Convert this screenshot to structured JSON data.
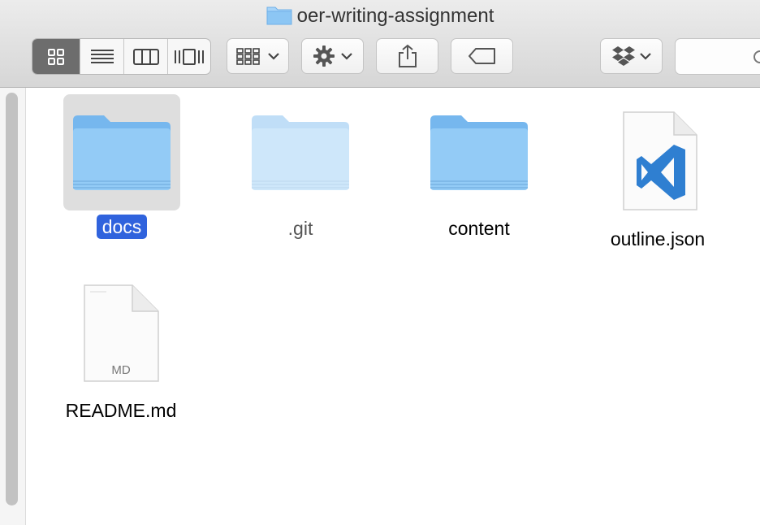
{
  "window": {
    "title": "oer-writing-assignment"
  },
  "toolbar": {
    "view_buttons": [
      "icon-view",
      "list-view",
      "column-view",
      "cover-flow-view"
    ],
    "arrange_button": "arrange-icon",
    "action_button": "gear-icon",
    "share_button": "share-icon",
    "tags_button": "tag-icon",
    "dropbox_button": "dropbox-icon",
    "search": {
      "placeholder": ""
    }
  },
  "files": [
    {
      "name": "docs",
      "type": "folder",
      "selected": true
    },
    {
      "name": ".git",
      "type": "folder",
      "hidden": true
    },
    {
      "name": "content",
      "type": "folder"
    },
    {
      "name": "outline.json",
      "type": "file",
      "icon": "vscode-document-icon"
    },
    {
      "name": "README.md",
      "type": "file",
      "icon": "md-document-icon",
      "badge": "MD"
    }
  ],
  "colors": {
    "selection": "#3063dd",
    "folder": "#8cc8f5"
  }
}
